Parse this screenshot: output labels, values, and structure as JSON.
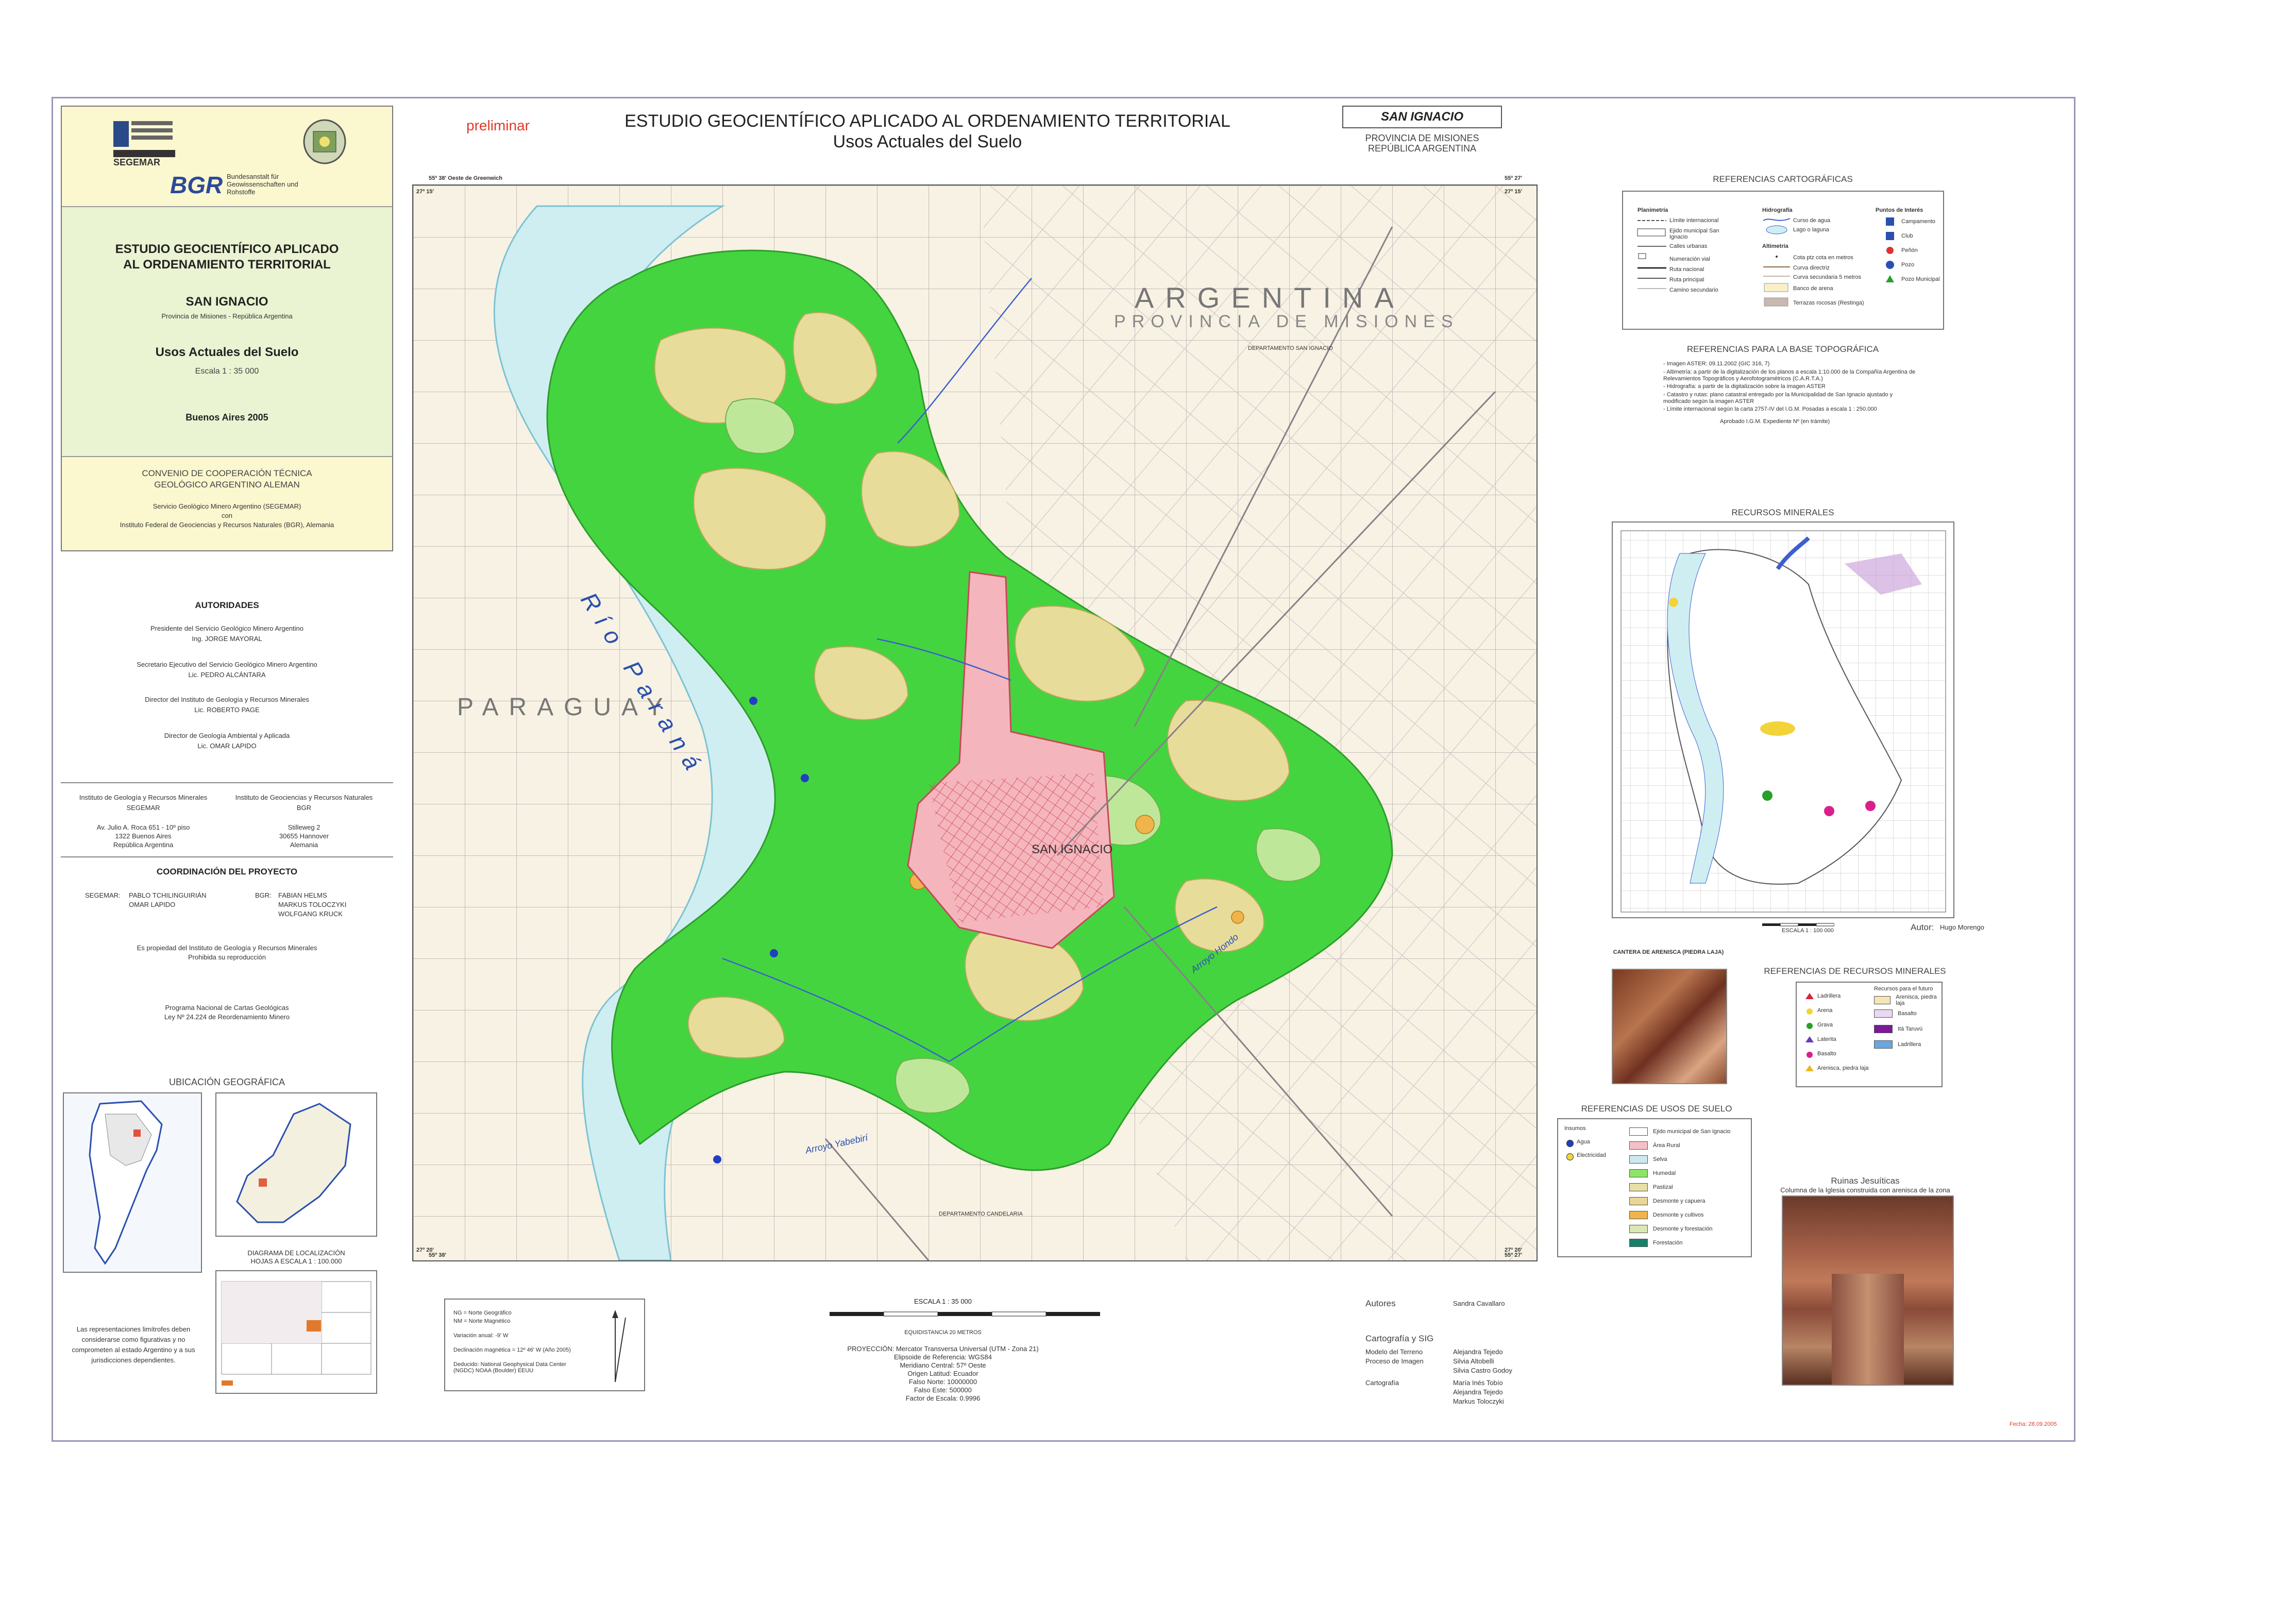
{
  "header": {
    "preliminar": "preliminar",
    "title": "ESTUDIO GEOCIENTÍFICO APLICADO AL ORDENAMIENTO TERRITORIAL",
    "subtitle": "Usos Actuales del Suelo",
    "sheet_name": "SAN IGNACIO",
    "province": "PROVINCIA DE MISIONES",
    "country": "REPÚBLICA ARGENTINA"
  },
  "left_panel": {
    "logo_segemar": "SEGEMAR",
    "logo_bgr": "BGR",
    "bgr_text": "Bundesanstalt für Geowissenschaften und Rohstoffe",
    "study_title_1": "ESTUDIO GEOCIENTÍFICO APLICADO",
    "study_title_2": "AL ORDENAMIENTO TERRITORIAL",
    "place": "SAN IGNACIO",
    "place_sub": "Provincia de Misiones - República Argentina",
    "theme": "Usos Actuales del Suelo",
    "scale": "Escala 1 : 35 000",
    "city_year": "Buenos Aires  2005",
    "conv_1": "CONVENIO DE COOPERACIÓN TÉCNICA",
    "conv_2": "GEOLÓGICO ARGENTINO ALEMAN",
    "conv_3": "Servicio Geológico Minero Argentino (SEGEMAR)",
    "conv_4": "con",
    "conv_5": "Instituto Federal de Geociencias y Recursos Naturales (BGR), Alemania",
    "authorities_title": "AUTORIDADES",
    "authorities": [
      "Presidente del Servicio Geológico Minero Argentino",
      "Ing. JORGE  MAYORAL",
      "Secretario Ejecutivo del Servicio Geológico Minero Argentino",
      "Lic. PEDRO  ALCÁNTARA",
      "Director del Instituto de Geología y Recursos Minerales",
      "Lic. ROBERTO  PAGE",
      "Director de Geología Ambiental y Aplicada",
      "Lic. OMAR  LAPIDO"
    ],
    "inst_left_1": "Instituto de Geología y Recursos Minerales",
    "inst_left_2": "SEGEMAR",
    "inst_left_3": "Av. Julio A. Roca 651 - 10º piso",
    "inst_left_4": "1322 Buenos Aires",
    "inst_left_5": "República Argentina",
    "inst_right_1": "Instituto de Geociencias y Recursos Naturales",
    "inst_right_2": "BGR",
    "inst_right_3": "Stilleweg 2",
    "inst_right_4": "30655 Hannover",
    "inst_right_5": "Alemania",
    "coord_title": "COORDINACIÓN DEL PROYECTO",
    "coord_segemar_label": "SEGEMAR:",
    "coord_segemar_1": "PABLO TCHILINGUIRIÁN",
    "coord_segemar_2": "OMAR LAPIDO",
    "coord_bgr_label": "BGR:",
    "coord_bgr_1": "FABIAN  HELMS",
    "coord_bgr_2": "MARKUS  TOLOCZYKI",
    "coord_bgr_3": "WOLFGANG  KRUCK",
    "property_1": "Es propiedad del Instituto de Geología y Recursos Minerales",
    "property_2": "Prohibida su reproducción",
    "program_1": "Programa Nacional de Cartas Geológicas",
    "program_2": "Ley Nº 24.224 de Reordenamiento Minero",
    "ubicacion": "UBICACIÓN GEOGRÁFICA",
    "diagram_1": "DIAGRAMA DE LOCALIZACIÓN",
    "diagram_2": "HOJAS A ESCALA 1 : 100.000",
    "disclaimer": "Las representaciones limítrofes deben considerarse como figurativas y no comprometen al estado Argentino y a sus jurisdicciones dependientes."
  },
  "map": {
    "argentina": "ARGENTINA",
    "prov": "PROVINCIA DE MISIONES",
    "paraguay": "PARAGUAY",
    "rio": "Río Paraná",
    "town": "SAN IGNACIO",
    "corner_tl": "27º 15'",
    "corner_tl_lon": "55º 38' Oeste de Greenwich",
    "corner_tr": "27º 15'",
    "corner_tr_lon": "55º 27'",
    "corner_bl": "27º 20'",
    "corner_bl_lon": "55º 38'",
    "corner_br": "27º 20'",
    "corner_br_lon": "55º 27'",
    "depto_1": "DEPARTAMENTO SAN IGNACIO",
    "depto_2": "DEPARTAMENTO CANDELARIA",
    "arroyo_1": "Arroyo Yabebirí",
    "arroyo_2": "Arroyo Hondo"
  },
  "bottom": {
    "scale_title": "ESCALA 1 : 35 000",
    "equid": "EQUIDISTANCIA 20 METROS",
    "projection": [
      "PROYECCIÓN:  Mercator Transversa Universal (UTM - Zona 21)",
      "Elipsoide de Referencia: WGS84",
      "Meridiano Central: 57º Oeste",
      "Origen Latitud: Ecuador",
      "Falso Norte: 10000000",
      "Falso Este: 500000",
      "Factor de Escala: 0.9996"
    ],
    "declination": [
      "NG = Norte Geográfico",
      "NM = Norte Magnético",
      "Variación anual: -9' W",
      "Declinación magnética = 12º 46' W (Año 2005)",
      "Deducido: National Geophysical Data Center (NGDC) NOAA (Boulder) EEUU"
    ],
    "autores_label": "Autores",
    "autores": "Sandra Cavallaro",
    "sig_label": "Cartografía y SIG",
    "modelo_label": "Modelo del Terreno",
    "modelo": "Alejandra Tejedo",
    "proceso_label": "Proceso de Imagen",
    "proceso": "Silvia Altobelli",
    "proceso_2": "Silvia Castro Godoy",
    "cartografia_label": "Cartografía",
    "cartografia_1": "María Inés Tobío",
    "cartografia_2": "Alejandra Tejedo",
    "cartografia_3": "Markus Toloczyki",
    "fecha": "Fecha: 28.09.2005"
  },
  "right_panel": {
    "ref_carto": "REFERENCIAS CARTOGRÁFICAS",
    "planimetria": "Planimetría",
    "hidrografia": "Hidrografía",
    "altimetria": "Altimetría",
    "puntos": "Puntos de Interés",
    "plan_items": [
      "Límite internacional",
      "Ejido municipal San Ignacio",
      "Calles urbanas",
      "Numeración vial",
      "Ruta nacional",
      "Ruta principal",
      "Camino secundario"
    ],
    "hidro_items": [
      "Curso de agua",
      "Lago o laguna"
    ],
    "alti_items": [
      "Cota ptz cota en metros",
      "Curva directriz",
      "Curva secundaria 5 metros",
      "Banco de arena",
      "Terrazas rocosas (Restinga)"
    ],
    "puntos_items": [
      "Campamento",
      "Club",
      "Peñón",
      "Pozo",
      "Pozo Municipal"
    ],
    "ref_base": "REFERENCIAS PARA LA BASE TOPOGRÁFICA",
    "base_items": [
      "- Imagen ASTER: 09.11.2002 (GIC 316, 7)",
      "- Altimetría: a partir de la digitalización de los planos a escala 1:10.000 de la Compañía Argentina de Relevamientos Topográficos y Aerofotogramétricos (C.A.R.T.A.)",
      "- Hidrografía: a partir de la digitalización sobre la imagen ASTER",
      "- Catastro y rutas: plano catastral entregado por la Municipalidad de San Ignacio ajustado y modificado según la imagen ASTER",
      "- Límite internacional según la carta 2757-IV del I.G.M. Posadas a escala 1 : 250.000"
    ],
    "base_aprob": "Aprobado I.G.M. Expediente Nº (en trámite)",
    "recursos_title": "RECURSOS MINERALES",
    "recursos_scale": "ESCALA 1 : 100 000",
    "autor_label": "Autor:",
    "autor": "Hugo Morengo",
    "photo1_caption": "CANTERA DE ARENISCA (PIEDRA LAJA)",
    "ref_recursos": "REFERENCIAS DE RECURSOS MINERALES",
    "recursos_left": [
      "Ladrillera",
      "Arena",
      "Grava",
      "Laterita",
      "Basalto",
      "Arenisca, piedra laja"
    ],
    "recursos_right_title": "Recursos para el futuro",
    "recursos_right": [
      "Arenisca, piedra laja",
      "Basalto",
      "Itá Taruvú",
      "Ladrillera"
    ],
    "ref_usos": "REFERENCIAS DE USOS DE SUELO",
    "insumos": "Insumos",
    "insumos_items": [
      "Agua",
      "Electricidad"
    ],
    "usos_items": [
      {
        "label": "Ejido municipal de San Ignacio",
        "color": "#ffffff"
      },
      {
        "label": "Área Rural",
        "color": "#f4c2c6"
      },
      {
        "label": "Selva",
        "color": "#cfe8f0"
      },
      {
        "label": "Humedal",
        "color": "#8fe36a"
      },
      {
        "label": "Pastizal",
        "color": "#e7e0a6"
      },
      {
        "label": "Desmonte y capuera",
        "color": "#e9d596"
      },
      {
        "label": "Desmonte y cultivos",
        "color": "#f0b44c"
      },
      {
        "label": "Desmonte y forestación",
        "color": "#d8e8b0"
      },
      {
        "label": "Forestación",
        "color": "#18806a"
      }
    ],
    "ruinas_title": "Ruinas Jesuíticas",
    "ruinas_caption": "Columna de la Iglesia construida con arenisca de la zona"
  },
  "colors": {
    "forest_green": "#3fd43a",
    "pasture": "#e7dc9a",
    "urban": "#f4b6bc",
    "river": "#cfeef2",
    "paraguay_land": "#f6f1de"
  }
}
